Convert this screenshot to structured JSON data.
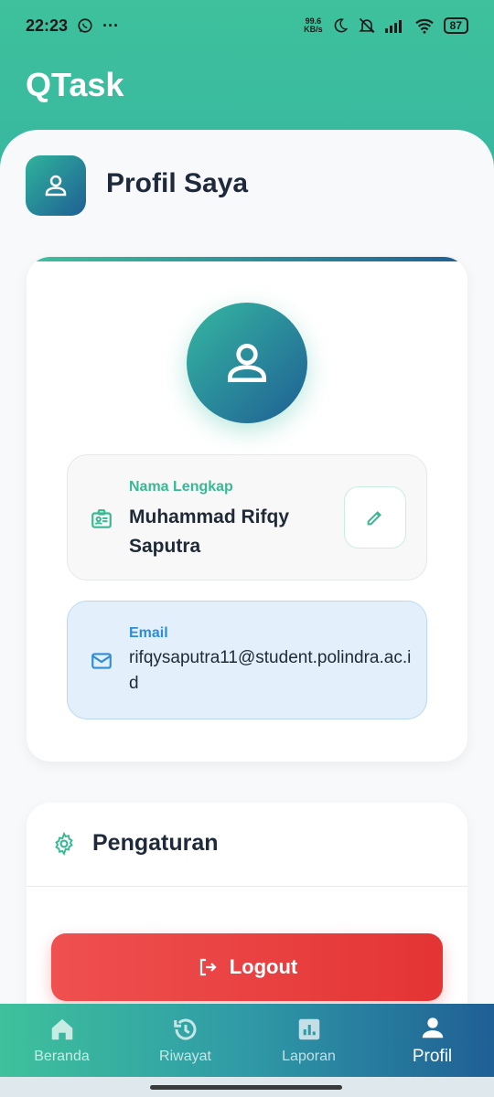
{
  "status_bar": {
    "time": "22:23",
    "more": "···",
    "net_speed_value": "99.6",
    "net_speed_unit": "KB/s",
    "battery": "87"
  },
  "app": {
    "title": "QTask"
  },
  "page": {
    "title": "Profil Saya"
  },
  "profile": {
    "name_label": "Nama Lengkap",
    "name_value": "Muhammad Rifqy Saputra",
    "email_label": "Email",
    "email_value": "rifqysaputra11@student.polindra.ac.id"
  },
  "settings": {
    "title": "Pengaturan",
    "logout_label": "Logout"
  },
  "bottom_nav": {
    "items": [
      {
        "label": "Beranda",
        "icon": "home-icon"
      },
      {
        "label": "Riwayat",
        "icon": "history-icon"
      },
      {
        "label": "Laporan",
        "icon": "chart-icon"
      },
      {
        "label": "Profil",
        "icon": "person-icon",
        "active": true
      }
    ]
  },
  "colors": {
    "primary_green": "#3ec19c",
    "primary_blue": "#1f5f95",
    "danger": "#e43434",
    "email_accent": "#2f8cd6"
  }
}
